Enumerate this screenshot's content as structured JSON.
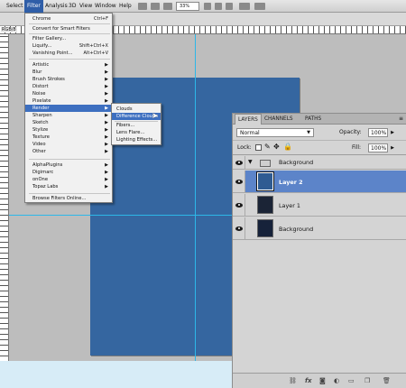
{
  "menubar": {
    "items": [
      "Select",
      "Filter",
      "Analysis",
      "3D",
      "View",
      "Window",
      "Help"
    ],
    "zoom": "33%"
  },
  "doc": {
    "tab": "RGB/8"
  },
  "filter_menu": {
    "top_items": [
      {
        "label": "Chrome",
        "shortcut": "Ctrl+F"
      },
      {
        "label": "Convert for Smart Filters",
        "shortcut": ""
      },
      {
        "label": "Filter Gallery...",
        "shortcut": ""
      },
      {
        "label": "Liquify...",
        "shortcut": "Shift+Ctrl+X"
      },
      {
        "label": "Vanishing Point...",
        "shortcut": "Alt+Ctrl+V"
      }
    ],
    "groups": [
      {
        "label": "Artistic",
        "arrow": "▶"
      },
      {
        "label": "Blur",
        "arrow": "▶"
      },
      {
        "label": "Brush Strokes",
        "arrow": "▶"
      },
      {
        "label": "Distort",
        "arrow": "▶"
      },
      {
        "label": "Noise",
        "arrow": "▶"
      },
      {
        "label": "Pixelate",
        "arrow": "▶"
      },
      {
        "label": "Render",
        "arrow": "▶"
      },
      {
        "label": "Sharpen",
        "arrow": "▶"
      },
      {
        "label": "Sketch",
        "arrow": "▶"
      },
      {
        "label": "Stylize",
        "arrow": "▶"
      },
      {
        "label": "Texture",
        "arrow": "▶"
      },
      {
        "label": "Video",
        "arrow": "▶"
      },
      {
        "label": "Other",
        "arrow": "▶"
      }
    ],
    "plugins": [
      {
        "label": "AlphaPlugins",
        "arrow": "▶"
      },
      {
        "label": "Digimarc",
        "arrow": "▶"
      },
      {
        "label": "onOne",
        "arrow": "▶"
      },
      {
        "label": "Topaz Labs",
        "arrow": "▶"
      }
    ],
    "browse": "Browse Filters Online..."
  },
  "render_submenu": {
    "items": [
      "Clouds",
      "Difference Clouds",
      "Fibers...",
      "Lens Flare...",
      "Lighting Effects..."
    ]
  },
  "layers_panel": {
    "tabs": [
      "LAYERS",
      "CHANNELS",
      "PATHS"
    ],
    "blend_mode": "Normal",
    "opacity_label": "Opacity:",
    "opacity_value": "100%",
    "lock_label": "Lock:",
    "fill_label": "Fill:",
    "fill_value": "100%",
    "layers": [
      {
        "name": "Background",
        "kind": "group"
      },
      {
        "name": "Layer 2",
        "kind": "layer",
        "selected": true
      },
      {
        "name": "Layer 1",
        "kind": "layer"
      },
      {
        "name": "Background",
        "kind": "layer"
      }
    ]
  },
  "colors": {
    "canvas": "#3566a0",
    "guide": "#2db7e8",
    "highlight": "#3d6fc0",
    "selected_layer": "#5c84c9"
  }
}
